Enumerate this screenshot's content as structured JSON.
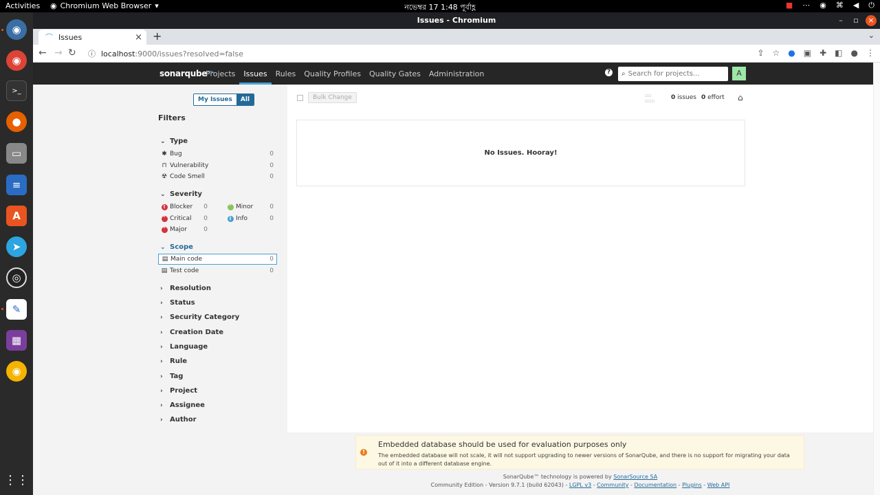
{
  "os": {
    "activities": "Activities",
    "app_menu": "Chromium Web Browser",
    "clock": "নভেম্বর 17  1:48 পূর্বাহ্ণ"
  },
  "window": {
    "title": "Issues - Chromium"
  },
  "browser": {
    "tab_title": "Issues",
    "url_host": "localhost",
    "url_path": ":9000/issues?resolved=false"
  },
  "sonar": {
    "logo": "sonarqube",
    "nav": {
      "projects": "Projects",
      "issues": "Issues",
      "rules": "Rules",
      "quality_profiles": "Quality Profiles",
      "quality_gates": "Quality Gates",
      "administration": "Administration"
    },
    "search_placeholder": "Search for projects...",
    "avatar": "A"
  },
  "filters": {
    "my_issues": "My Issues",
    "all": "All",
    "title": "Filters",
    "type": {
      "label": "Type",
      "items": [
        {
          "label": "Bug",
          "count": "0"
        },
        {
          "label": "Vulnerability",
          "count": "0"
        },
        {
          "label": "Code Smell",
          "count": "0"
        }
      ]
    },
    "severity": {
      "label": "Severity",
      "items": [
        {
          "label": "Blocker",
          "count": "0"
        },
        {
          "label": "Minor",
          "count": "0"
        },
        {
          "label": "Critical",
          "count": "0"
        },
        {
          "label": "Info",
          "count": "0"
        },
        {
          "label": "Major",
          "count": "0"
        }
      ]
    },
    "scope": {
      "label": "Scope",
      "items": [
        {
          "label": "Main code",
          "count": "0"
        },
        {
          "label": "Test code",
          "count": "0"
        }
      ]
    },
    "collapsed": [
      "Resolution",
      "Status",
      "Security Category",
      "Creation Date",
      "Language",
      "Rule",
      "Tag",
      "Project",
      "Assignee",
      "Author"
    ]
  },
  "main": {
    "bulk_change": "Bulk Change",
    "issues_count": "0",
    "issues_label": "issues",
    "effort_count": "0",
    "effort_label": "effort",
    "no_issues": "No Issues. Hooray!"
  },
  "warning": {
    "title": "Embedded database should be used for evaluation purposes only",
    "text": "The embedded database will not scale, it will not support upgrading to newer versions of SonarQube, and there is no support for migrating your data out of it into a different database engine."
  },
  "footer": {
    "powered_prefix": "SonarQube™ technology is powered by",
    "powered_link": "SonarSource SA",
    "edition": "Community Edition - Version 9.7.1 (build 62043) -",
    "links": [
      "LGPL v3",
      "Community",
      "Documentation",
      "Plugins",
      "Web API"
    ]
  },
  "colors": {
    "sonar_blue": "#236a97",
    "header_dark": "#262626",
    "accent_blue": "#4b9fd5",
    "avatar_green": "#9ee6a6",
    "warning_orange": "#ed7d20"
  }
}
